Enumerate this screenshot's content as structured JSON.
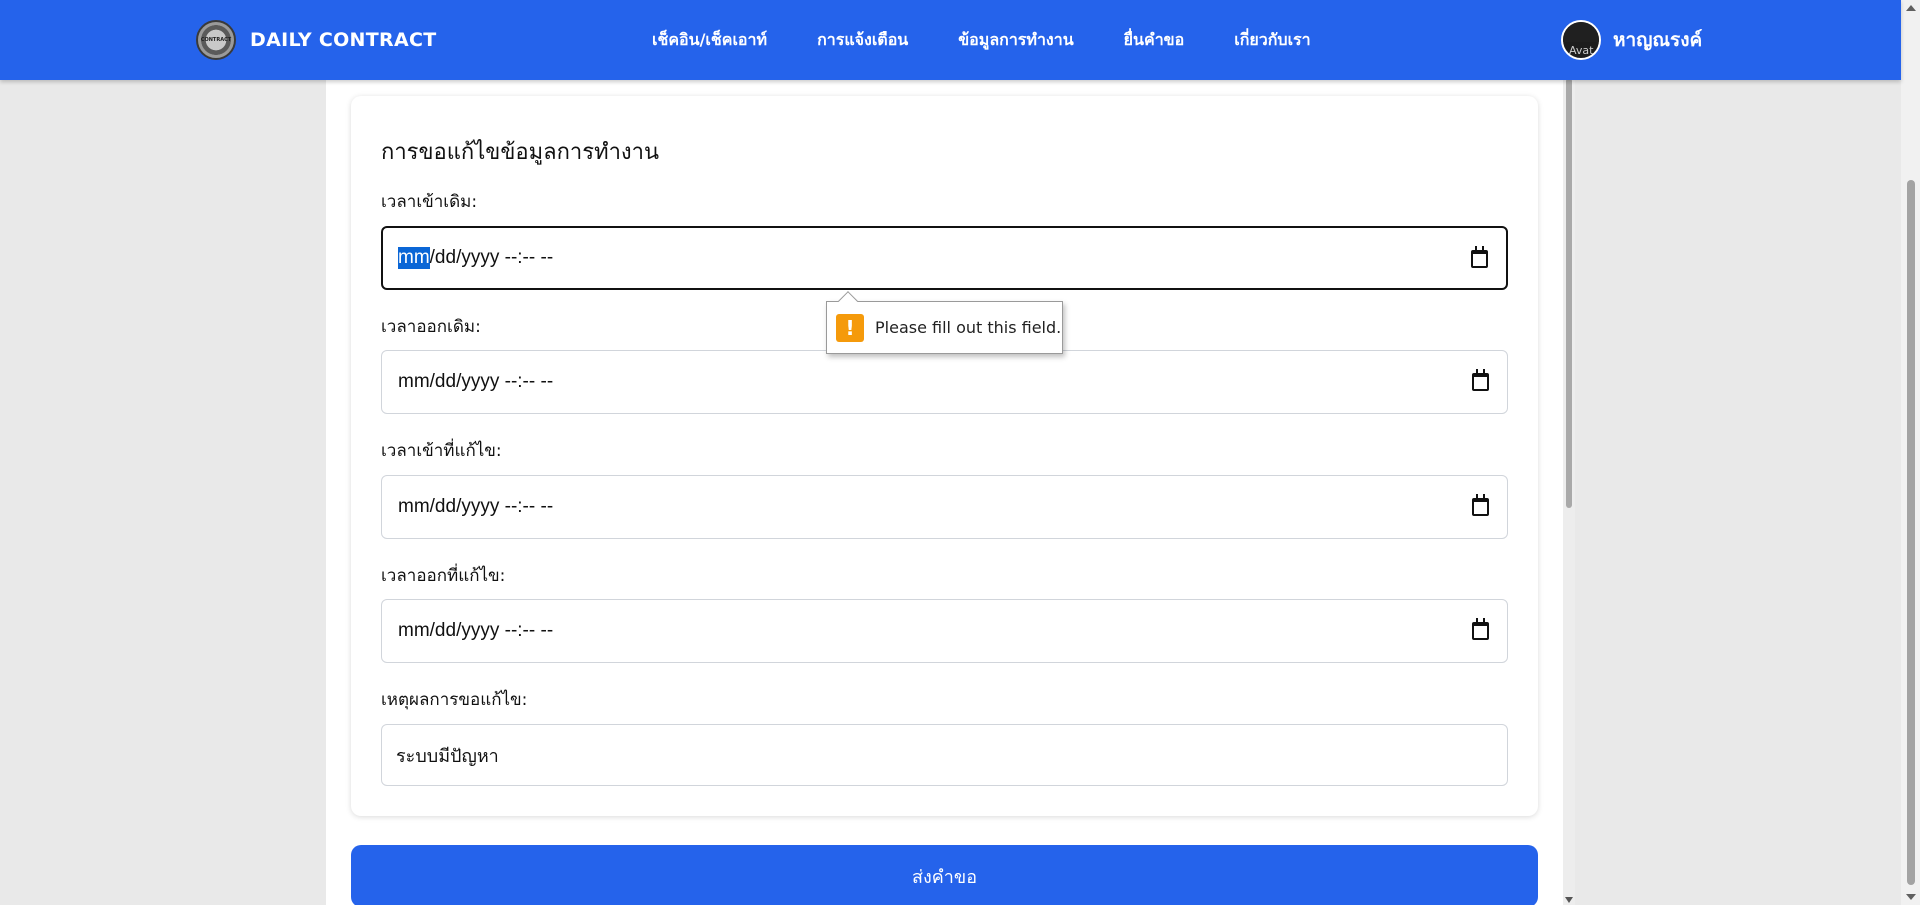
{
  "navbar": {
    "brand": "DAILY CONTRACT",
    "logo_text": "CONTRACT",
    "links": [
      "เช็คอิน/เช็คเอาท์",
      "การแจ้งเตือน",
      "ข้อมูลการทำงาน",
      "ยื่นคำขอ",
      "เกี่ยวกับเรา"
    ],
    "avatar_alt": "Avat",
    "username": "หาญณรงค์",
    "color": "#2563eb"
  },
  "form": {
    "title": "การขอแก้ไขข้อมูลการทำงาน",
    "fields": [
      {
        "label": "เวลาเข้าเดิม:",
        "selected": "mm",
        "value_rest": "/dd/yyyy --:-- --"
      },
      {
        "label": "เวลาออกเดิม:",
        "value": "mm/dd/yyyy --:-- --"
      },
      {
        "label": "เวลาเข้าที่แก้ไข:",
        "value": "mm/dd/yyyy --:-- --"
      },
      {
        "label": "เวลาออกที่แก้ไข:",
        "value": "mm/dd/yyyy --:-- --"
      }
    ],
    "reason": {
      "label": "เหตุผลการขอแก้ไข:",
      "value": "ระบบมีปัญหา"
    },
    "submit_label": "ส่งคำขอ"
  },
  "validation": {
    "icon": "!",
    "message": "Please fill out this field.",
    "icon_color": "#f59a0b"
  }
}
